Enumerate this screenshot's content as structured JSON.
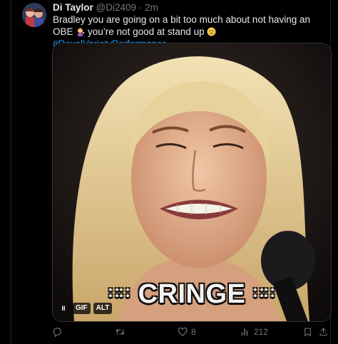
{
  "author": {
    "name": "Di Taylor",
    "handle": "@Di2409",
    "separator": "·",
    "time": "2m"
  },
  "tweet": {
    "text_part1": "Bradley you are going on a bit too much about not having an OBE",
    "text_part2": " you’re not good at stand up ",
    "hashtag": "#RoyalVarietyPerformance",
    "emoji_1": "person-tipping-hand-emoji",
    "emoji_2": "confused-face-emoji"
  },
  "media": {
    "caption_dots_left": "∷∷",
    "caption_text": "CRINGE",
    "caption_dots_right": "∷∷",
    "pause_label": "II",
    "gif_badge": "GIF",
    "alt_badge": "ALT"
  },
  "actions": {
    "reply": {
      "icon": "reply-icon",
      "count": ""
    },
    "retweet": {
      "icon": "retweet-icon",
      "count": ""
    },
    "like": {
      "icon": "heart-icon",
      "count": "8"
    },
    "views": {
      "icon": "views-icon",
      "count": "212"
    },
    "bookmark": {
      "icon": "bookmark-icon"
    },
    "share": {
      "icon": "share-icon"
    }
  },
  "colors": {
    "background": "#000000",
    "text": "#e7e9ea",
    "muted": "#71767b",
    "link": "#1d9bf0"
  }
}
